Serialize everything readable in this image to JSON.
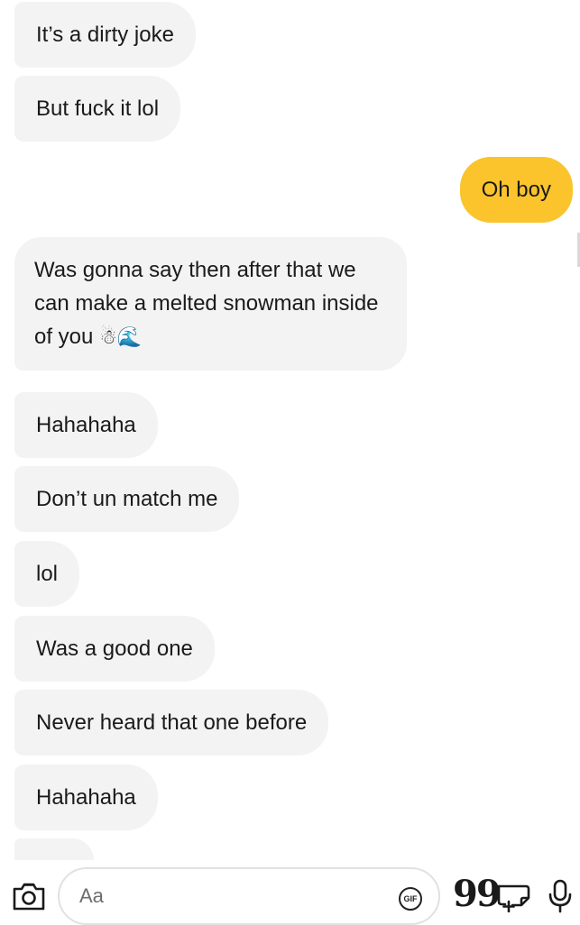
{
  "conversation": {
    "messages": [
      {
        "sender": "them",
        "text": "It’s a dirty joke"
      },
      {
        "sender": "them",
        "text": "But fuck it lol"
      },
      {
        "sender": "me",
        "text": "Oh boy"
      },
      {
        "sender": "them",
        "text": "Was gonna say then after that we can make a melted snowman inside of you",
        "emojis": "☃🌊"
      },
      {
        "sender": "them",
        "text": "Hahahaha"
      },
      {
        "sender": "them",
        "text": "Don’t un match me"
      },
      {
        "sender": "them",
        "text": "lol"
      },
      {
        "sender": "them",
        "text": "Was a good one"
      },
      {
        "sender": "them",
        "text": "Never heard that one before"
      },
      {
        "sender": "them",
        "text": "Hahahaha"
      }
    ]
  },
  "composer": {
    "placeholder": "Aa",
    "gif_label": "GIF",
    "quote_glyph": "99",
    "icons": [
      "camera-icon",
      "gif-icon",
      "quote-icon",
      "sticker-add-icon",
      "microphone-icon"
    ]
  },
  "colors": {
    "incoming_bubble": "#f3f3f3",
    "outgoing_bubble": "#fbc42c",
    "text": "#1a1a1a"
  }
}
